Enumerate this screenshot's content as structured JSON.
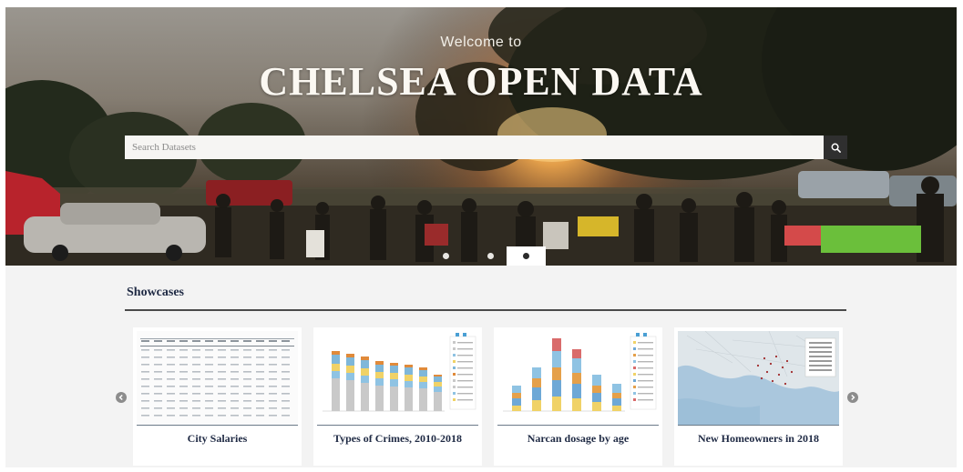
{
  "hero": {
    "welcome": "Welcome to",
    "title": "CHELSEA OPEN DATA",
    "search_placeholder": "Search Datasets",
    "search_icon": "search-icon",
    "slides": 3,
    "active_slide": 3
  },
  "showcases": {
    "title": "Showcases",
    "prev_icon": "chevron-left-icon",
    "next_icon": "chevron-right-icon",
    "cards": [
      {
        "label": "City Salaries",
        "thumb": "table"
      },
      {
        "label": "Types of Crimes, 2010-2018",
        "thumb": "bar-chart"
      },
      {
        "label": "Narcan dosage by age",
        "thumb": "bar-chart"
      },
      {
        "label": "New Homeowners in 2018",
        "thumb": "map"
      }
    ]
  },
  "colors": {
    "heading": "#1f2a44",
    "search_button": "#2f2f2f",
    "page_bg": "#f3f3f3"
  }
}
